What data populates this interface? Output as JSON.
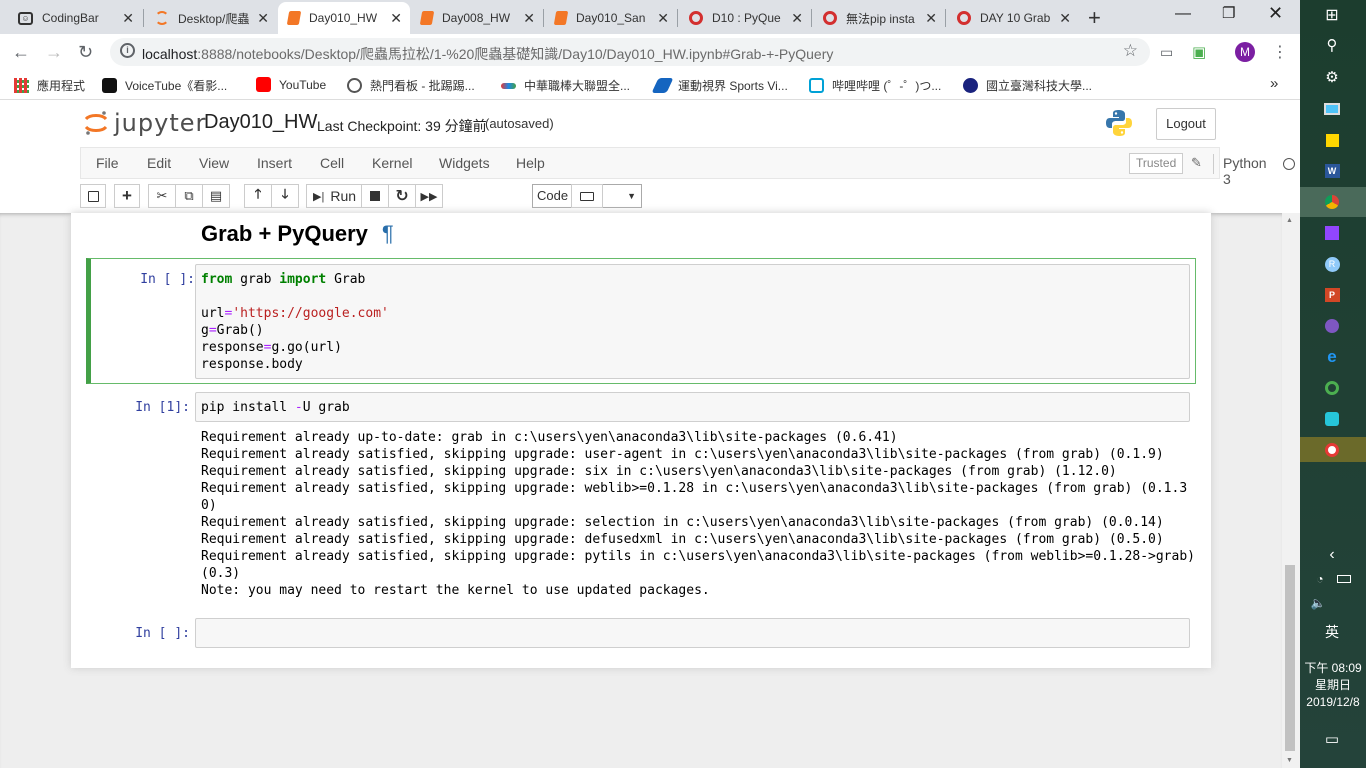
{
  "browser": {
    "tabs": [
      {
        "label": "CodingBar",
        "icon": "codingbar-icon"
      },
      {
        "label": "Desktop/爬蟲",
        "icon": "jupyter-icon"
      },
      {
        "label": "Day010_HW",
        "icon": "notebook-icon"
      },
      {
        "label": "Day008_HW",
        "icon": "notebook-icon"
      },
      {
        "label": "Day010_San",
        "icon": "notebook-icon"
      },
      {
        "label": "D10 : PyQue",
        "icon": "cupoy-icon"
      },
      {
        "label": "無法pip insta",
        "icon": "cupoy-icon"
      },
      {
        "label": "DAY 10 Grab",
        "icon": "cupoy-icon"
      }
    ],
    "url_host": "localhost",
    "url_path": ":8888/notebooks/Desktop/爬蟲馬拉松/1-%20爬蟲基礎知識/Day10/Day010_HW.ipynb#Grab-+-PyQuery",
    "profile_initial": "M",
    "bookmarks": [
      "應用程式",
      "VoiceTube《看影...",
      "YouTube",
      "熱門看板 - 批踢踢...",
      "中華職棒大聯盟全...",
      "運動視界 Sports Vi...",
      "哔哩哔哩 (゜-゜)つ...",
      "國立臺灣科技大學..."
    ],
    "bookmarks_more": "»"
  },
  "jupyter": {
    "logo_text": "jupyter",
    "notebook_name": "Day010_HW",
    "checkpoint": "Last Checkpoint: 39 分鐘前",
    "autosave": "(autosaved)",
    "logout": "Logout",
    "menu": [
      "File",
      "Edit",
      "View",
      "Insert",
      "Cell",
      "Kernel",
      "Widgets",
      "Help"
    ],
    "trusted": "Trusted",
    "kernel": "Python 3",
    "run_label": "Run",
    "cell_type": "Code"
  },
  "notebook": {
    "heading": "Grab + PyQuery",
    "pilcrow": "¶",
    "cell1": {
      "prompt": "In [ ]:",
      "code": [
        "",
        "",
        "url='https://google.com'",
        "g=Grab()",
        "response=g.go(url)",
        "response.body"
      ]
    },
    "cell2": {
      "prompt": "In [1]:",
      "code": "pip install -U grab",
      "output": "Requirement already up-to-date: grab in c:\\users\\yen\\anaconda3\\lib\\site-packages (0.6.41)\nRequirement already satisfied, skipping upgrade: user-agent in c:\\users\\yen\\anaconda3\\lib\\site-packages (from grab) (0.1.9)\nRequirement already satisfied, skipping upgrade: six in c:\\users\\yen\\anaconda3\\lib\\site-packages (from grab) (1.12.0)\nRequirement already satisfied, skipping upgrade: weblib>=0.1.28 in c:\\users\\yen\\anaconda3\\lib\\site-packages (from grab) (0.1.3\n0)\nRequirement already satisfied, skipping upgrade: selection in c:\\users\\yen\\anaconda3\\lib\\site-packages (from grab) (0.0.14)\nRequirement already satisfied, skipping upgrade: defusedxml in c:\\users\\yen\\anaconda3\\lib\\site-packages (from grab) (0.5.0)\nRequirement already satisfied, skipping upgrade: pytils in c:\\users\\yen\\anaconda3\\lib\\site-packages (from weblib>=0.1.28->grab)\n(0.3)\nNote: you may need to restart the kernel to use updated packages."
    },
    "cell3": {
      "prompt": "In [ ]:",
      "code": ""
    }
  },
  "taskbar": {
    "ime": "英",
    "time": "下午 08:09",
    "weekday": "星期日",
    "date": "2019/12/8"
  }
}
